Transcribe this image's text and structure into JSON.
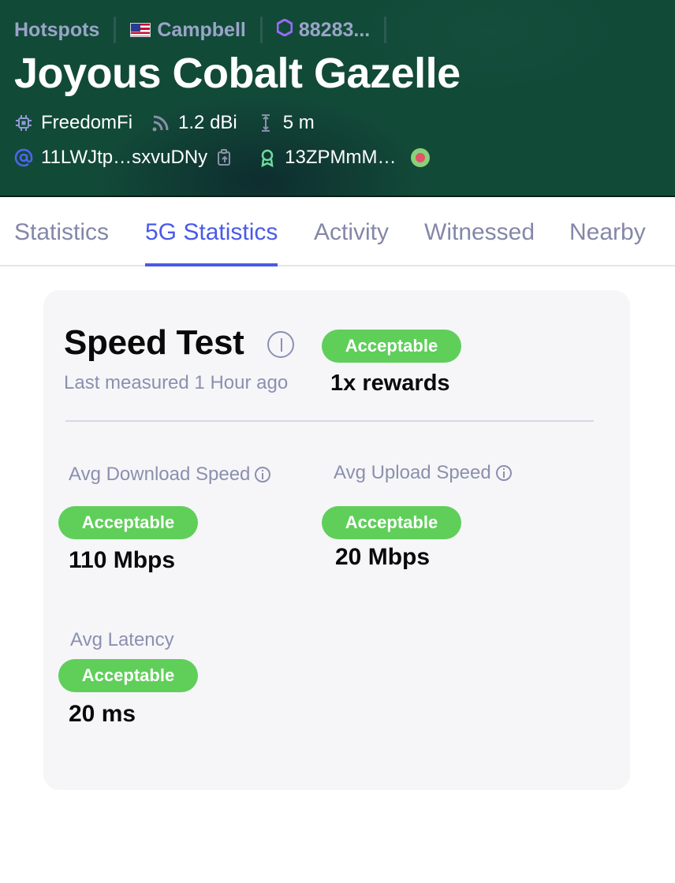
{
  "header": {
    "breadcrumbs": {
      "hotspots": "Hotspots",
      "location": "Campbell",
      "hex": "88283..."
    },
    "title": "Joyous Cobalt Gazelle",
    "maker": "FreedomFi",
    "antenna_gain": "1.2 dBi",
    "elevation": "5 m",
    "address": "11LWJtp…sxvuDNy",
    "owner": "13ZPMmM…",
    "colors": {
      "background": "#124a38",
      "accent": "#4a5ae8"
    }
  },
  "tabs": [
    {
      "label": "Statistics",
      "active": false
    },
    {
      "label": "5G Statistics",
      "active": true
    },
    {
      "label": "Activity",
      "active": false
    },
    {
      "label": "Witnessed",
      "active": false
    },
    {
      "label": "Nearby",
      "active": false
    }
  ],
  "speed_test": {
    "title": "Speed Test",
    "status": "Acceptable",
    "last_measured": "Last measured 1 Hour ago",
    "rewards": "1x rewards",
    "metrics": {
      "download": {
        "label": "Avg Download Speed",
        "status": "Acceptable",
        "value": "110 Mbps"
      },
      "upload": {
        "label": "Avg Upload Speed",
        "status": "Acceptable",
        "value": "20 Mbps"
      },
      "latency": {
        "label": "Avg Latency",
        "status": "Acceptable",
        "value": "20 ms"
      }
    }
  }
}
